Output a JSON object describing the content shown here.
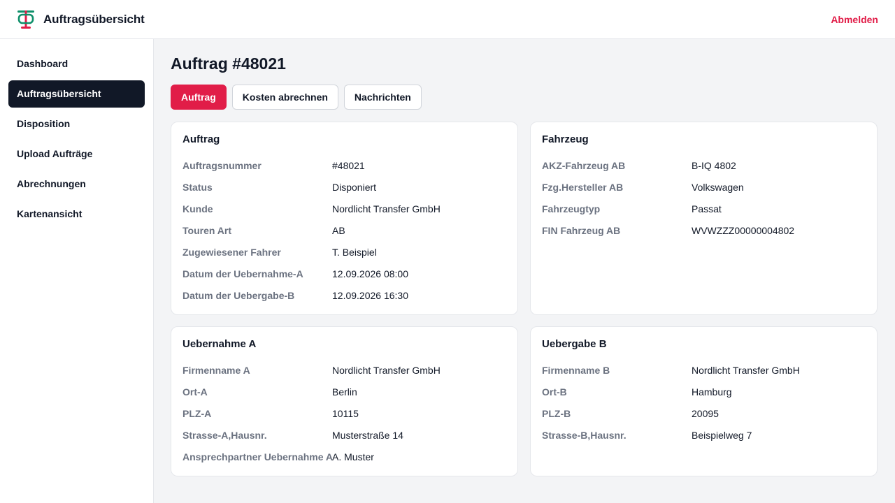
{
  "header": {
    "title": "Auftragsübersicht",
    "logout_label": "Abmelden",
    "logo_icon": "tram-icon",
    "accent_color": "#e11d48",
    "logo_green": "#0f8f6a"
  },
  "sidebar": {
    "items": [
      {
        "label": "Dashboard",
        "active": false
      },
      {
        "label": "Auftragsübersicht",
        "active": true
      },
      {
        "label": "Disposition",
        "active": false
      },
      {
        "label": "Upload Aufträge",
        "active": false
      },
      {
        "label": "Abrechnungen",
        "active": false
      },
      {
        "label": "Kartenansicht",
        "active": false
      }
    ]
  },
  "main": {
    "title": "Auftrag #48021",
    "tabs": [
      {
        "label": "Auftrag",
        "active": true
      },
      {
        "label": "Kosten abrechnen",
        "active": false
      },
      {
        "label": "Nachrichten",
        "active": false
      }
    ],
    "cards": {
      "auftrag": {
        "title": "Auftrag",
        "rows": [
          {
            "label": "Auftragsnummer",
            "value": "#48021"
          },
          {
            "label": "Status",
            "value": "Disponiert"
          },
          {
            "label": "Kunde",
            "value": "Nordlicht Transfer GmbH"
          },
          {
            "label": "Touren Art",
            "value": "AB"
          },
          {
            "label": "Zugewiesener Fahrer",
            "value": "T. Beispiel"
          },
          {
            "label": "Datum der Uebernahme-A",
            "value": "12.09.2026 08:00"
          },
          {
            "label": "Datum der Uebergabe-B",
            "value": "12.09.2026 16:30"
          }
        ]
      },
      "fahrzeug": {
        "title": "Fahrzeug",
        "rows": [
          {
            "label": "AKZ-Fahrzeug AB",
            "value": "B-IQ 4802"
          },
          {
            "label": "Fzg.Hersteller AB",
            "value": "Volkswagen"
          },
          {
            "label": "Fahrzeugtyp",
            "value": "Passat"
          },
          {
            "label": "FIN Fahrzeug AB",
            "value": "WVWZZZ00000004802"
          }
        ]
      },
      "uebernahme": {
        "title": "Uebernahme A",
        "rows": [
          {
            "label": "Firmenname A",
            "value": "Nordlicht Transfer GmbH"
          },
          {
            "label": "Ort-A",
            "value": "Berlin"
          },
          {
            "label": "PLZ-A",
            "value": "10115"
          },
          {
            "label": "Strasse-A,Hausnr.",
            "value": "Musterstraße 14"
          },
          {
            "label": "Ansprechpartner Uebernahme A",
            "value": "A. Muster"
          }
        ]
      },
      "uebergabe": {
        "title": "Uebergabe B",
        "rows": [
          {
            "label": "Firmenname B",
            "value": "Nordlicht Transfer GmbH"
          },
          {
            "label": "Ort-B",
            "value": "Hamburg"
          },
          {
            "label": "PLZ-B",
            "value": "20095"
          },
          {
            "label": "Strasse-B,Hausnr.",
            "value": "Beispielweg 7"
          }
        ]
      }
    }
  }
}
